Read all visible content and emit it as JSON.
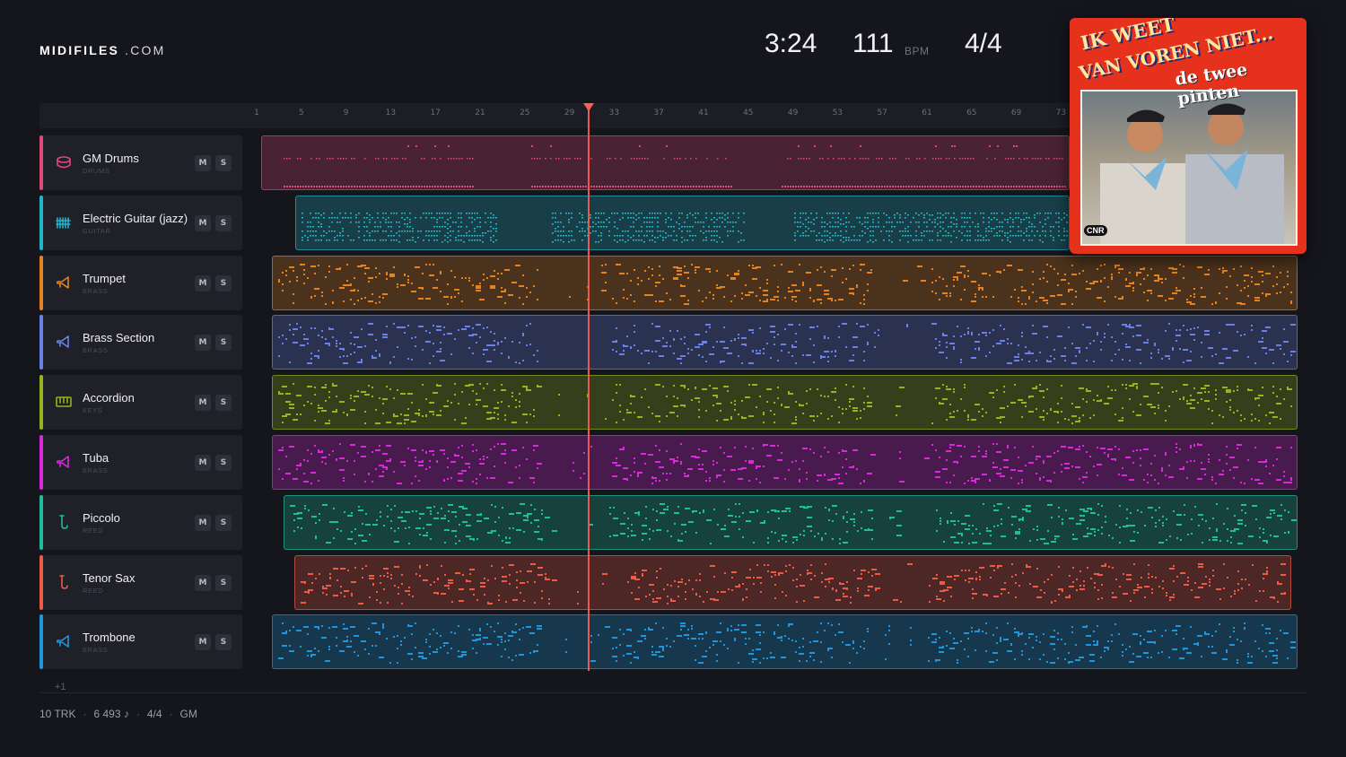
{
  "brand": {
    "bold": "MIDIFILES",
    "rest": ".COM"
  },
  "transport": {
    "time": "3:24",
    "tempo": "111",
    "tempo_unit": "BPM",
    "signature": "4/4"
  },
  "ruler": {
    "labels": [
      "1",
      "5",
      "9",
      "13",
      "17",
      "21",
      "25",
      "29",
      "33",
      "37",
      "41",
      "45",
      "49",
      "53",
      "57",
      "61",
      "65",
      "69",
      "73"
    ]
  },
  "tracks": [
    {
      "name": "GM Drums",
      "category": "DRUMS",
      "color": "#e0487a",
      "icon": "drum-icon",
      "mute": "M",
      "solo": "S"
    },
    {
      "name": "Electric Guitar (jazz)",
      "category": "GUITAR",
      "color": "#22b4c8",
      "icon": "guitar-icon",
      "mute": "M",
      "solo": "S"
    },
    {
      "name": "Trumpet",
      "category": "BRASS",
      "color": "#e6821e",
      "icon": "horn-icon",
      "mute": "M",
      "solo": "S"
    },
    {
      "name": "Brass Section",
      "category": "BRASS",
      "color": "#6a82e8",
      "icon": "horn-icon",
      "mute": "M",
      "solo": "S"
    },
    {
      "name": "Accordion",
      "category": "KEYS",
      "color": "#96b41e",
      "icon": "keys-icon",
      "mute": "M",
      "solo": "S"
    },
    {
      "name": "Tuba",
      "category": "BRASS",
      "color": "#dc28dc",
      "icon": "horn-icon",
      "mute": "M",
      "solo": "S"
    },
    {
      "name": "Piccolo",
      "category": "REED",
      "color": "#1ebe9b",
      "icon": "reed-icon",
      "mute": "M",
      "solo": "S"
    },
    {
      "name": "Tenor Sax",
      "category": "REED",
      "color": "#ee5a46",
      "icon": "reed-icon",
      "mute": "M",
      "solo": "S"
    },
    {
      "name": "Trombone",
      "category": "BRASS",
      "color": "#1e96dc",
      "icon": "horn-icon",
      "mute": "M",
      "solo": "S"
    }
  ],
  "more_tracks": "+1",
  "footer": {
    "tracks": "10 TRK",
    "notes": "6 493 ♪",
    "signature": "4/4",
    "standard": "GM"
  },
  "cover": {
    "title_line1": "IK WEET",
    "title_line2": "VAN VOREN NIET...",
    "artist": "de twee pinten",
    "label": "CNR"
  }
}
